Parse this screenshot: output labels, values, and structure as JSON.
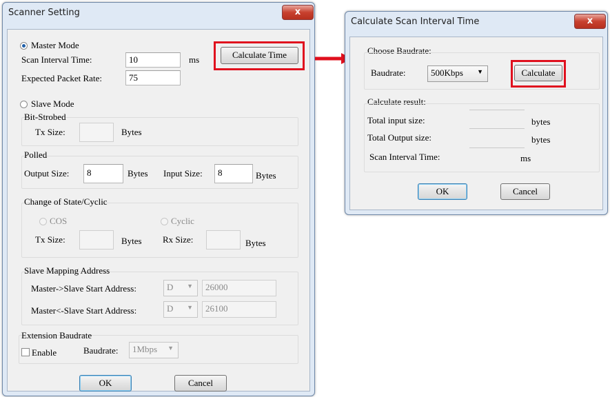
{
  "scanner": {
    "title": "Scanner Setting",
    "close_label": "x",
    "master_mode": "Master Mode",
    "scan_interval_label": "Scan Interval Time:",
    "scan_interval_value": "10",
    "scan_interval_unit": "ms",
    "calc_time_button": "Calculate Time",
    "packet_rate_label": "Expected Packet Rate:",
    "packet_rate_value": "75",
    "slave_mode": "Slave Mode",
    "bit_strobed": {
      "title": "Bit-Strobed",
      "tx_label": "Tx Size:",
      "tx_value": "",
      "tx_unit": "Bytes"
    },
    "polled": {
      "title": "Polled",
      "output_label": "Output Size:",
      "output_value": "8",
      "output_unit": "Bytes",
      "input_label": "Input Size:",
      "input_value": "8",
      "input_unit": "Bytes"
    },
    "cos": {
      "title": "Change of State/Cyclic",
      "cos_label": "COS",
      "cyclic_label": "Cyclic",
      "tx_label": "Tx Size:",
      "tx_unit": "Bytes",
      "rx_label": "Rx Size:",
      "rx_unit": "Bytes"
    },
    "mapping": {
      "title": "Slave Mapping Address",
      "m2s_label": "Master->Slave Start Address:",
      "m2s_device": "D",
      "m2s_address": "26000",
      "s2m_label": "Master<-Slave Start Address:",
      "s2m_device": "D",
      "s2m_address": "26100"
    },
    "ext": {
      "title": "Extension Baudrate",
      "enable_label": "Enable",
      "baud_label": "Baudrate:",
      "baud_value": "1Mbps"
    },
    "ok_label": "OK",
    "cancel_label": "Cancel"
  },
  "calc": {
    "title": "Calculate Scan Interval Time",
    "close_label": "x",
    "choose_label": "Choose Baudrate:",
    "baud_label": "Baudrate:",
    "baud_value": "500Kbps",
    "calculate_button": "Calculate",
    "result_label": "Calculate result:",
    "total_input_label": "Total input size:",
    "total_input_unit": "bytes",
    "total_output_label": "Total Output size:",
    "total_output_unit": "bytes",
    "scan_interval_label": "Scan Interval Time:",
    "scan_interval_unit": "ms",
    "ok_label": "OK",
    "cancel_label": "Cancel"
  },
  "colors": {
    "highlight": "#e0101e",
    "arrow": "#e0101e"
  }
}
